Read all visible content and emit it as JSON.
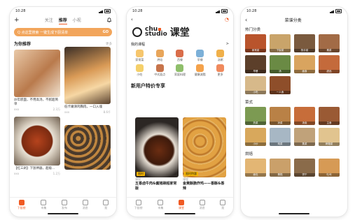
{
  "status": {
    "time": "10:28"
  },
  "home": {
    "tabs": [
      "关注",
      "推荐",
      "小视"
    ],
    "active_tab": "推荐",
    "banner_text": "Q 点这里搜索 一键生成下厨清单",
    "banner_go": "GO",
    "section_title": "为你推荐",
    "section_more": "更多",
    "cards": [
      {
        "text": "炒年糕面，不用高汤，不腻超简单",
        "author": "xxx",
        "count": "2.3万"
      },
      {
        "text": "低卡嫩滑鸡胸肉，一口入魂",
        "author": "xxx",
        "count": "8.6千"
      },
      {
        "text": "【红三剁】下饭神器，超级...",
        "author": "xxx",
        "count": "1.2万"
      },
      {
        "text": "",
        "author": "",
        "count": ""
      }
    ],
    "tabbar": [
      "下厨房",
      "市集",
      "发布",
      "消息",
      "我"
    ]
  },
  "course": {
    "brand_top": "chu",
    "brand_bottom": "studio",
    "brand_title": "课堂",
    "cat_title": "我的课程",
    "cat_more": ">",
    "categories": [
      "家常菜",
      "烘焙",
      "西餐",
      "早餐",
      "汤粥",
      "小吃",
      "中式面点",
      "家庭料理",
      "健康减脂",
      "更多"
    ],
    "new_title": "新用户特价专享",
    "promos": [
      {
        "tag": "限时",
        "store": "课程",
        "text": "五香卤牛肉&酱猪蹄超家常版"
      },
      {
        "tag": "限时特惠",
        "store": "课程",
        "text": "金黄酥脆炸鸡——香酥&香辣"
      }
    ],
    "tabbar": [
      "下厨房",
      "市集",
      "课堂",
      "消息",
      "我"
    ]
  },
  "categories_page": {
    "title": "菜谱分类",
    "sections": [
      {
        "name": "热门分类",
        "items": [
          "家常菜",
          "下饭菜",
          "快手菜",
          "素菜",
          "早餐",
          "汤",
          "面食",
          "甜品",
          "小吃",
          "一人食"
        ]
      },
      {
        "name": "菜式",
        "items": [
          "热菜",
          "凉菜",
          "汤羹",
          "主食",
          "小炒",
          "炖菜",
          "蒸菜",
          "烤箱菜"
        ]
      },
      {
        "name": "烘焙",
        "items": [
          "面包",
          "蛋糕",
          "饼干",
          "吐司",
          "",
          "",
          "",
          ""
        ]
      }
    ]
  }
}
